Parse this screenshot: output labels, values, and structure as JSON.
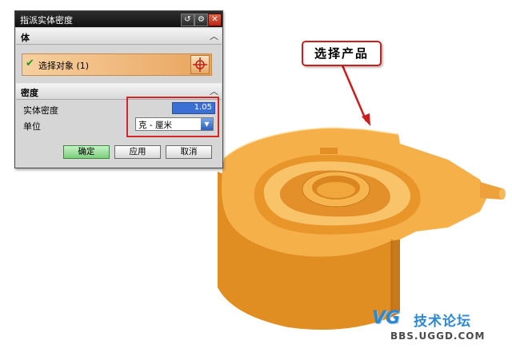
{
  "dialog": {
    "title": "指派实体密度",
    "title_buttons": {
      "reset_icon": "reset-icon",
      "settings_icon": "gear-icon",
      "close_label": "✕"
    },
    "body_section": {
      "label": "体",
      "select_object_label": "选择对象 (1)",
      "select_icon": "crosshair-icon"
    },
    "density_section": {
      "label": "密度",
      "density_label": "实体密度",
      "density_value": "1.05",
      "unit_label": "单位",
      "unit_value": "克 - 厘米"
    },
    "buttons": {
      "ok": "确定",
      "apply": "应用",
      "cancel": "取消"
    }
  },
  "annotation": {
    "callout_text": "选择产品",
    "color": "#cc1c1c"
  },
  "watermark": {
    "logo": "VG",
    "forum": "技术论坛",
    "url": "BBS.UGGD.COM"
  },
  "colors": {
    "model": "#f2a73c",
    "selection_row": "#e9a55e",
    "ok_button": "#7ccf7c"
  }
}
